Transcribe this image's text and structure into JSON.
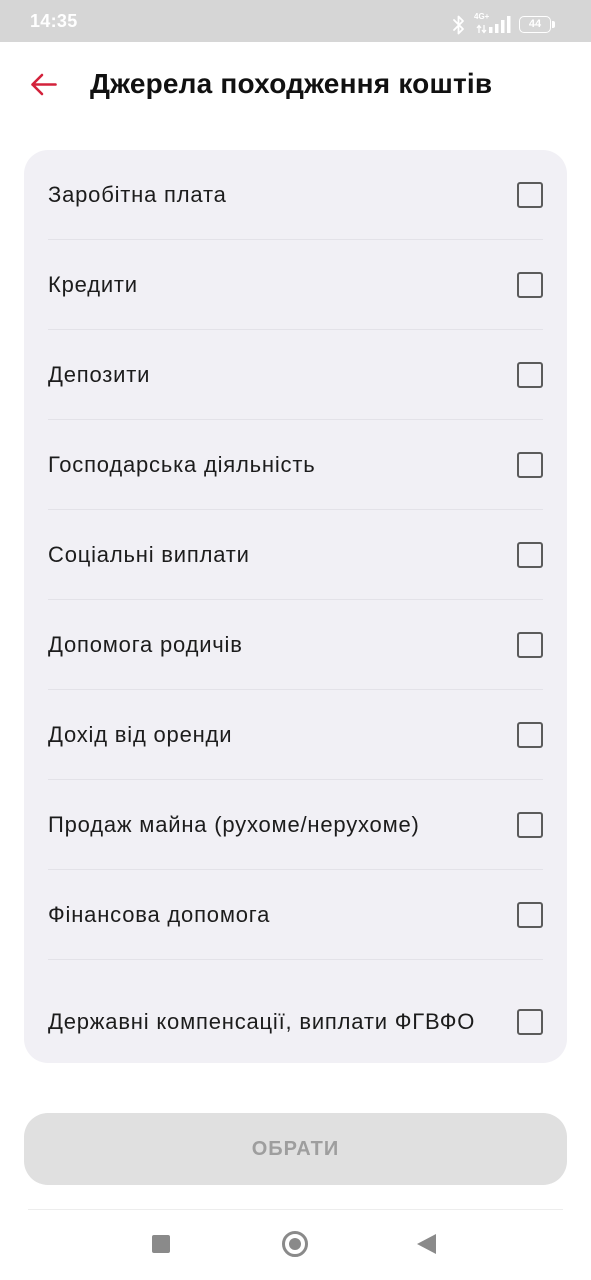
{
  "status_bar": {
    "time": "14:35",
    "network": "4G+",
    "battery": "44",
    "icons": [
      "bluetooth-icon",
      "signal-icon",
      "battery-icon"
    ]
  },
  "header": {
    "title": "Джерела походження коштів",
    "back_icon": "arrow-left-icon"
  },
  "options": [
    {
      "label": "Заробітна плата",
      "checked": false
    },
    {
      "label": "Кредити",
      "checked": false
    },
    {
      "label": "Депозити",
      "checked": false
    },
    {
      "label": "Господарська діяльність",
      "checked": false
    },
    {
      "label": "Соціальні виплати",
      "checked": false
    },
    {
      "label": "Допомога родичів",
      "checked": false
    },
    {
      "label": "Дохід від оренди",
      "checked": false
    },
    {
      "label": "Продаж майна (рухоме/нерухоме)",
      "checked": false
    },
    {
      "label": "Фінансова допомога",
      "checked": false
    },
    {
      "label": "Державні компенсації, виплати ФГВФО",
      "checked": false
    }
  ],
  "submit": {
    "label": "ОБРАТИ",
    "disabled": true
  },
  "navigation": {
    "icons": [
      "recents-square-icon",
      "home-circle-icon",
      "back-triangle-icon"
    ]
  },
  "colors": {
    "accent": "#d3223b",
    "card_background": "#f1f0f5",
    "button_background": "#e0e0e0",
    "button_text": "#9e9e9e",
    "status_bar": "#d6d6d6"
  }
}
